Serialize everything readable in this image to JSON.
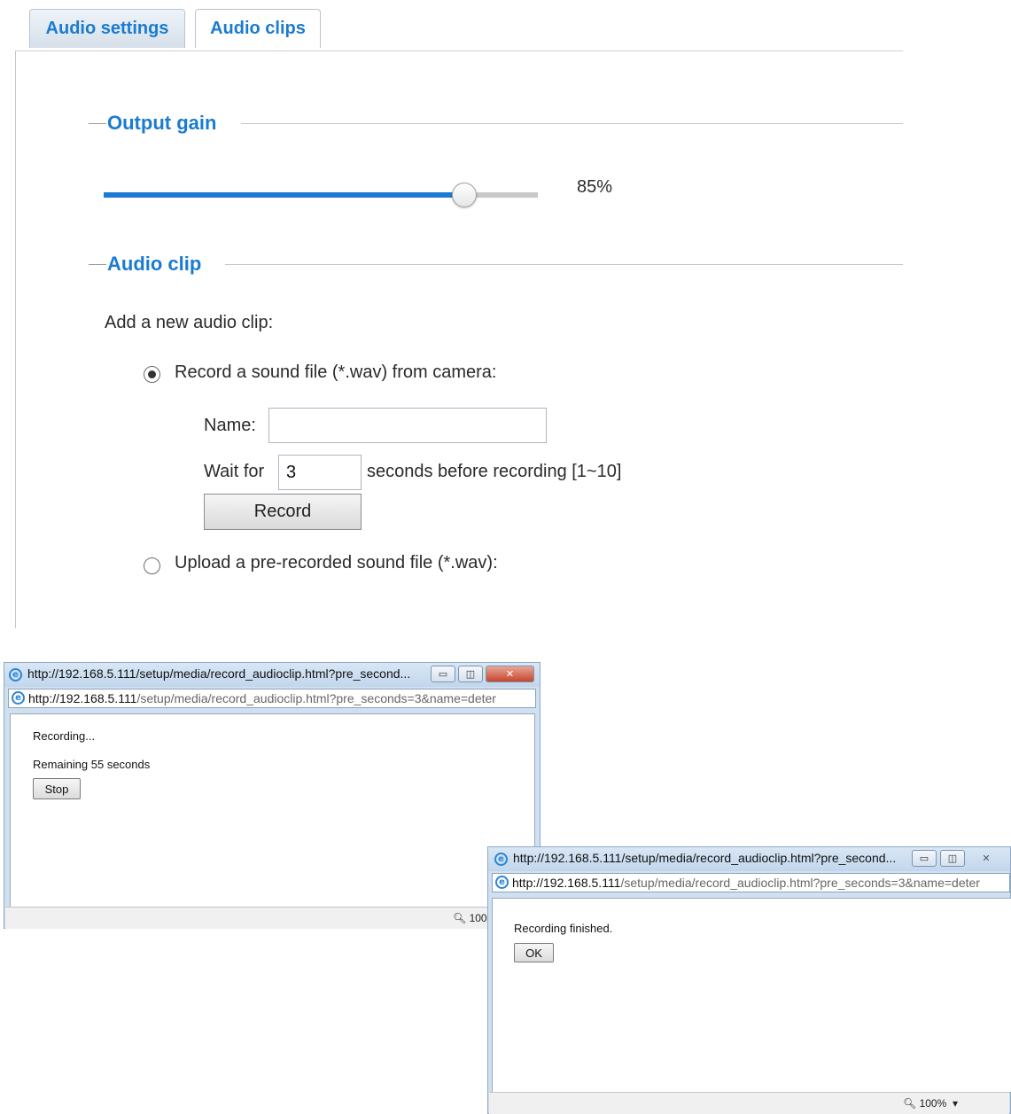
{
  "tabs": [
    {
      "label": "Audio settings",
      "active": true
    },
    {
      "label": "Audio clips",
      "active": false
    }
  ],
  "output_gain": {
    "legend": "Output gain",
    "slider_percent": 85,
    "value_label": "85%"
  },
  "audio_clip": {
    "legend": "Audio clip",
    "add_new_label": "Add a new audio clip:",
    "record_option": {
      "label": "Record a sound file (*.wav) from camera:",
      "selected": true
    },
    "name_label": "Name:",
    "name_value": "",
    "wait_label": "Wait for",
    "wait_value": "3",
    "wait_suffix": "seconds before recording [1~10]",
    "record_button": "Record",
    "upload_option": {
      "label": "Upload a pre-recorded sound file (*.wav):",
      "selected": false
    }
  },
  "popup_recording": {
    "title": "http://192.168.5.111/setup/media/record_audioclip.html?pre_second...",
    "address_host": "http://192.168.5.111",
    "address_path": "/setup/media/record_audioclip.html?pre_seconds=3&name=deter",
    "status_text": "Recording...",
    "remaining_text": "Remaining 55 seconds",
    "stop_button": "Stop",
    "zoom": "100%"
  },
  "popup_finished": {
    "title": "http://192.168.5.111/setup/media/record_audioclip.html?pre_second...",
    "address_host": "http://192.168.5.111",
    "address_path": "/setup/media/record_audioclip.html?pre_seconds=3&name=deter",
    "status_text": "Recording finished.",
    "ok_button": "OK",
    "zoom": "100%"
  },
  "colors": {
    "accent": "#1a7bd1",
    "slider_fill": "#1a7bd1",
    "slider_track": "#c8c8c8"
  },
  "icons": [
    "ie-icon",
    "minimize-icon",
    "maximize-icon",
    "close-icon",
    "zoom-icon",
    "chevron-down-icon"
  ]
}
